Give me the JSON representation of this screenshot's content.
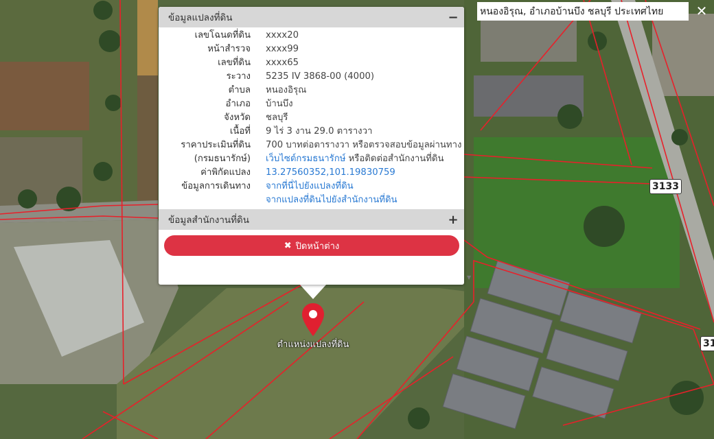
{
  "address_search": {
    "text": "หนองอิรุณ, อำเภอบ้านบึง ชลบุรี ประเทศไทย",
    "close_glyph": "✕"
  },
  "popup": {
    "parcel_section": {
      "title": "ข้อมูลแปลงที่ดิน",
      "toggle_glyph": "−",
      "rows": {
        "deed_no": {
          "label": "เลขโฉนดที่ดิน",
          "value": "xxxx20"
        },
        "survey_page": {
          "label": "หน้าสำรวจ",
          "value": "xxxx99"
        },
        "land_no": {
          "label": "เลขที่ดิน",
          "value": "xxxx65"
        },
        "map_sheet": {
          "label": "ระวาง",
          "value": "5235 IV 3868-00 (4000)"
        },
        "subdistrict": {
          "label": "ตำบล",
          "value": "หนองอิรุณ"
        },
        "district": {
          "label": "อำเภอ",
          "value": "บ้านบึง"
        },
        "province": {
          "label": "จังหวัด",
          "value": "ชลบุรี"
        },
        "area": {
          "label": "เนื้อที่",
          "value": "9 ไร่ 3 งาน 29.0 ตารางวา"
        },
        "price": {
          "label": "ราคาประเมินที่ดิน",
          "value": "700 บาทต่อตารางวา หรือตรวจสอบข้อมูลผ่านทาง"
        },
        "price_source": {
          "label": "(กรมธนารักษ์)",
          "link": "เว็บไซต์กรมธนารักษ์",
          "suffix": " หรือติดต่อสำนักงานที่ดิน"
        },
        "coordinates": {
          "label": "ค่าพิกัดแปลง",
          "value": "13.27560352,101.19830759"
        },
        "directions": {
          "label": "ข้อมูลการเดินทาง",
          "link1": "จากที่นี่ไปยังแปลงที่ดิน",
          "link2": "จากแปลงที่ดินไปยังสำนักงานที่ดิน"
        }
      }
    },
    "office_section": {
      "title": "ข้อมูลสำนักงานที่ดิน",
      "toggle_glyph": "+"
    },
    "close_button": {
      "icon_glyph": "✖",
      "label": "ปิดหน้าต่าง"
    }
  },
  "map": {
    "road_labels": [
      "3133",
      "31"
    ],
    "marker_label": "ตำแหน่งแปลงที่ดิน",
    "colors": {
      "parcel_line": "#e8202a",
      "marker": "#e02030",
      "close_button": "#dd3344",
      "link": "#2a7ad3"
    },
    "icons": [
      "map-marker-icon",
      "plus-icon",
      "minus-icon",
      "close-icon"
    ]
  }
}
